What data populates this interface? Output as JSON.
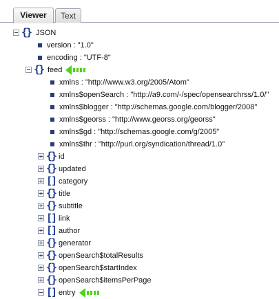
{
  "tabs": [
    {
      "label": "Viewer",
      "active": true
    },
    {
      "label": "Text",
      "active": false
    }
  ],
  "colors": {
    "arrow": "#4ed319",
    "icon": "#1e3d8f",
    "leaf": "#2a3e73"
  },
  "tree": {
    "root": {
      "label": "JSON",
      "expanded": true
    },
    "version": "version : \"1.0\"",
    "encoding": "encoding : \"UTF-8\"",
    "feed": {
      "label": "feed",
      "expanded": true
    },
    "feed_attrs": [
      "xmlns : \"http://www.w3.org/2005/Atom\"",
      "xmlns$openSearch : \"http://a9.com/-/spec/opensearchrss/1.0/\"",
      "xmlns$blogger : \"http://schemas.google.com/blogger/2008\"",
      "xmlns$georss : \"http://www.georss.org/georss\"",
      "xmlns$gd : \"http://schemas.google.com/g/2005\"",
      "xmlns$thr : \"http://purl.org/syndication/thread/1.0\""
    ],
    "feed_children": [
      {
        "label": "id",
        "kind": "object"
      },
      {
        "label": "updated",
        "kind": "object"
      },
      {
        "label": "category",
        "kind": "array"
      },
      {
        "label": "title",
        "kind": "object"
      },
      {
        "label": "subtitle",
        "kind": "object"
      },
      {
        "label": "link",
        "kind": "array"
      },
      {
        "label": "author",
        "kind": "array"
      },
      {
        "label": "generator",
        "kind": "object"
      },
      {
        "label": "openSearch$totalResults",
        "kind": "object"
      },
      {
        "label": "openSearch$startIndex",
        "kind": "object"
      },
      {
        "label": "openSearch$itemsPerPage",
        "kind": "object"
      },
      {
        "label": "entry",
        "kind": "array",
        "expanded": true
      }
    ]
  }
}
